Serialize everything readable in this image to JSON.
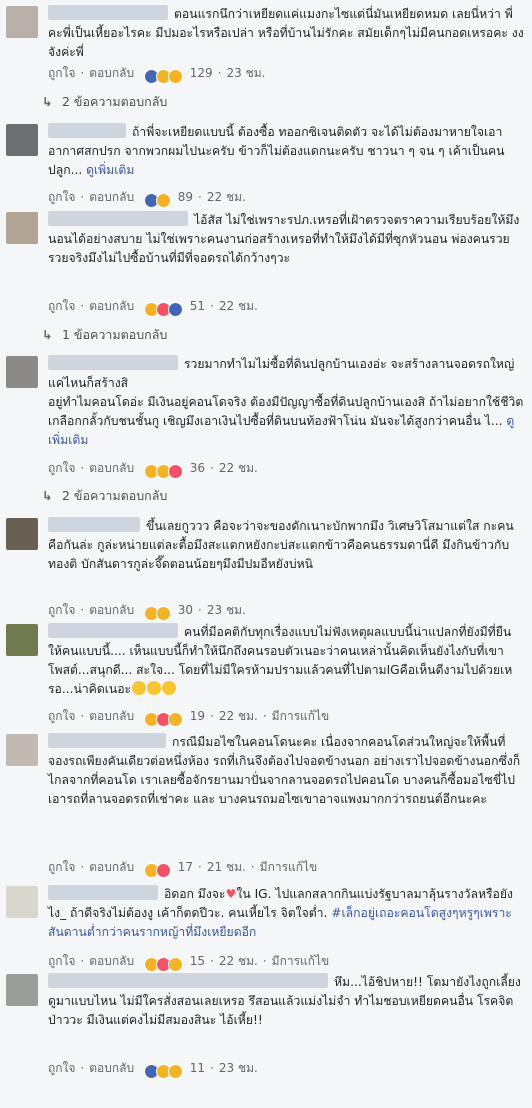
{
  "labels": {
    "like": "ถูกใจ",
    "reply": "ตอบกลับ",
    "edited": "มีการแก้ไข",
    "see_more": "ดูเพิ่มเติม"
  },
  "comments": [
    {
      "text": "ตอนแรกนึกว่าเหยียดแค่แมงกะไซแต่นี่มันเหยียดหมด เลยนี่หว่า พี่คะพี่เป็นเหี้ยอะไรคะ มีปมอะไรหรือเปล่า หรือที่บ้านไม่รักคะ สมัยเด็กๆไม่มีคนกอดเหรอคะ งงจังค่ะพี่",
      "reaction_count": "129",
      "time": "23 ชม.",
      "replies": "2 ข้อความตอบกลับ"
    },
    {
      "text": "ถ้าพี่จะเหยียดแบบนี้ ต้องซื้อ ทออกซิเจนติดตัว จะได้ไม่ต้องมาหายใจเอาอากาศสกปรก จากพวกผมไปนะครับ ข้าวก็ไม่ต้องแดกนะครับ ชาวนา ๆ จน ๆ เค้าเป็นคนปลูก...",
      "see_more": "ดูเพิ่มเติม",
      "reaction_count": "89",
      "time": "22 ชม."
    },
    {
      "text": "ไอ้สัส ไม่ใช่เพราะรปภ.เหรอที่เฝ้าตรวจตราความเรียบร้อยให้มึงนอนได้อย่างสบาย ไม่ใช่เพราะคนงานก่อสร้างเหรอที่ทำให้มึงได้มีที่ซุกหัวนอน พ่องคนรวย รวยจริงมึงไม่ไปซื้อบ้านที่มีที่จอดรถได้กว้างๆวะ",
      "reaction_count": "51",
      "time": "22 ชม.",
      "replies": "1 ข้อความตอบกลับ"
    },
    {
      "text1": "รวยมากทำไมไม่ซื้อที่ดินปลูกบ้านเองอ่ะ จะสร้างลานจอดรถใหญ่แค่ไหนก็สร้างสิ",
      "text2": "อยู่ทำไมคอนโดอ่ะ มีเงินอยู่คอนโดจริง ต้องมีปัญญาซื้อที่ดินปลูกบ้านเองสิ ถ้าไม่อยากใช้ชีวิตเกลือกกลั้วกับชนชั้นกู เชิญมึงเอาเงินไปซื้อที่ดินบนท้องฟ้าโน่น มันจะได้สูงกว่าคนอื่น ไ...",
      "see_more": "ดูเพิ่มเติม",
      "reaction_count": "36",
      "time": "22 ชม.",
      "replies": "2 ข้อความตอบกลับ"
    },
    {
      "text": "ขึ้นเลยกูววว คือจะว่าจะของดักเนาะบักพากมึง วิเศษวิโสมาแต่ใส กะคนคือกันล่ะ กูล่ะหน่ายแต่ละตื้อมึงสะแตกหยังกะบ่สะแตกข้าวคือคนธรรมดานี่ดี มึงกินข้าวกับทองติ บักสันดารกูล่ะจึ๊ดตอนน้อยๆมึงมีปมอีหยังบ่หนิ",
      "reaction_count": "30",
      "time": "23 ชม."
    },
    {
      "text": "คนที่มีอคติกับทุกเรื่องแบบไม่ฟังเหตุผลแบบนี้น่าแปลกที่ยังมีที่ยืนให้คนแบบนี้.... เห็นแบบนี้ก็ทำให้นึกถึงคนรอบตัวเนอะว่าคนเหล่านั้นคิดเห็นยังไงกับที่เขาโพสต์...สนุกดี... สะใจ... โดยที่ไม่มีใครห้ามปรามแล้วคนที่ไปตามIGคือเห็นดีงามไปด้วยเหรอ...น่าคิดเนอะ",
      "reaction_count": "19",
      "time": "22 ชม.",
      "edited": true
    },
    {
      "text": "กรณีมีมอไซในคอนโดนะคะ เนื่องจากคอนโดส่วนใหญ่จะให้พื้นที่จองรถเพียงคันเดียวต่อหนึ่งห้อง รถที่เกินจึงต้องไปจอดข้างนอก อย่างเราไปจอดข้างนอกซึ่งก็ไกลจากที่คอนโด เราเลยซื้อจักรยานมาปั่นจากลานจอดรถไปคอนโด บางคนก็ซื้อมอไซขี่ไปเอารถที่ลานจอดรถที่เช่าคะ และ บางคนรถมอไซเขาอาจแพงมากกว่ารถยนต์อีกนะคะ",
      "reaction_count": "17",
      "time": "21 ชม.",
      "edited": true
    },
    {
      "text_a": "อิดอก มึงจะ",
      "text_b": "ใน IG. ไปแลกสลากกินแบ่งรัฐบาลมาลุ้นรางวัลหรือยังไง_ ถ้าดีจริงไม่ต้องงู เค้าก็ตดปีวะ. คนเหี้ยไร จิตใจต่ำ.",
      "hashtag": "#เล็กอยู่เถอะคอนโดสูงๆหรูๆเพราะสันดานต่ำกว่าคนรากหญ้าที่มึงเหยียดอีก",
      "reaction_count": "15",
      "time": "22 ชม.",
      "edited": true
    },
    {
      "text": "หึม...ไอ้ชิปหาย!! โตมายังไงถูกเลี้ยงดูมาแบบไหน ไม่มีใครสั่งสอนเลยเหรอ รึสอนแล้วแม่งไม่จำ ทำไมชอบเหยียดคนอื่น โรคจิตป่าววะ มีเงินแต่คงไม่มีสมองสินะ ไอ้เหี้ย!!",
      "reaction_count": "11",
      "time": "23 ชม."
    }
  ]
}
